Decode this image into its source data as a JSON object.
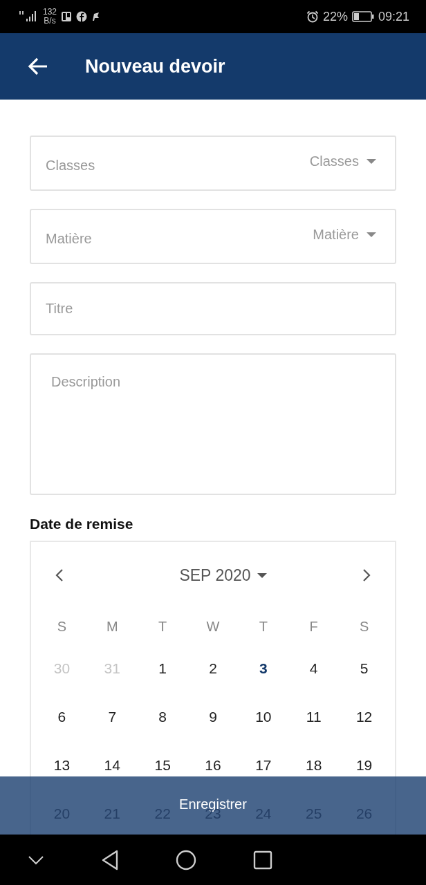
{
  "status_bar": {
    "speed_value": "132",
    "speed_unit": "B/s",
    "battery_percent": "22%",
    "time": "09:21"
  },
  "header": {
    "title": "Nouveau devoir"
  },
  "form": {
    "fields": [
      {
        "kind": "select",
        "label": "Classes",
        "value": "Classes"
      },
      {
        "kind": "select",
        "label": "Matière",
        "value": "Matière"
      },
      {
        "kind": "input",
        "placeholder": "Titre"
      },
      {
        "kind": "textarea",
        "placeholder": "Description"
      }
    ],
    "date_label": "Date de remise"
  },
  "calendar": {
    "month": "SEP 2020",
    "weekdays": [
      "S",
      "M",
      "T",
      "W",
      "T",
      "F",
      "S"
    ],
    "weeks": [
      [
        {
          "day": "30",
          "outside": true,
          "selected": false
        },
        {
          "day": "31",
          "outside": true,
          "selected": false
        },
        {
          "day": "1",
          "outside": false,
          "selected": false
        },
        {
          "day": "2",
          "outside": false,
          "selected": false
        },
        {
          "day": "3",
          "outside": false,
          "selected": true
        },
        {
          "day": "4",
          "outside": false,
          "selected": false
        },
        {
          "day": "5",
          "outside": false,
          "selected": false
        }
      ],
      [
        {
          "day": "6",
          "outside": false,
          "selected": false
        },
        {
          "day": "7",
          "outside": false,
          "selected": false
        },
        {
          "day": "8",
          "outside": false,
          "selected": false
        },
        {
          "day": "9",
          "outside": false,
          "selected": false
        },
        {
          "day": "10",
          "outside": false,
          "selected": false
        },
        {
          "day": "11",
          "outside": false,
          "selected": false
        },
        {
          "day": "12",
          "outside": false,
          "selected": false
        }
      ],
      [
        {
          "day": "13",
          "outside": false,
          "selected": false
        },
        {
          "day": "14",
          "outside": false,
          "selected": false
        },
        {
          "day": "15",
          "outside": false,
          "selected": false
        },
        {
          "day": "16",
          "outside": false,
          "selected": false
        },
        {
          "day": "17",
          "outside": false,
          "selected": false
        },
        {
          "day": "18",
          "outside": false,
          "selected": false
        },
        {
          "day": "19",
          "outside": false,
          "selected": false
        }
      ],
      [
        {
          "day": "20",
          "outside": false,
          "selected": false
        },
        {
          "day": "21",
          "outside": false,
          "selected": false
        },
        {
          "day": "22",
          "outside": false,
          "selected": false
        },
        {
          "day": "23",
          "outside": false,
          "selected": false
        },
        {
          "day": "24",
          "outside": false,
          "selected": false
        },
        {
          "day": "25",
          "outside": false,
          "selected": false
        },
        {
          "day": "26",
          "outside": false,
          "selected": false
        }
      ]
    ]
  },
  "save_button": "Enregistrer"
}
